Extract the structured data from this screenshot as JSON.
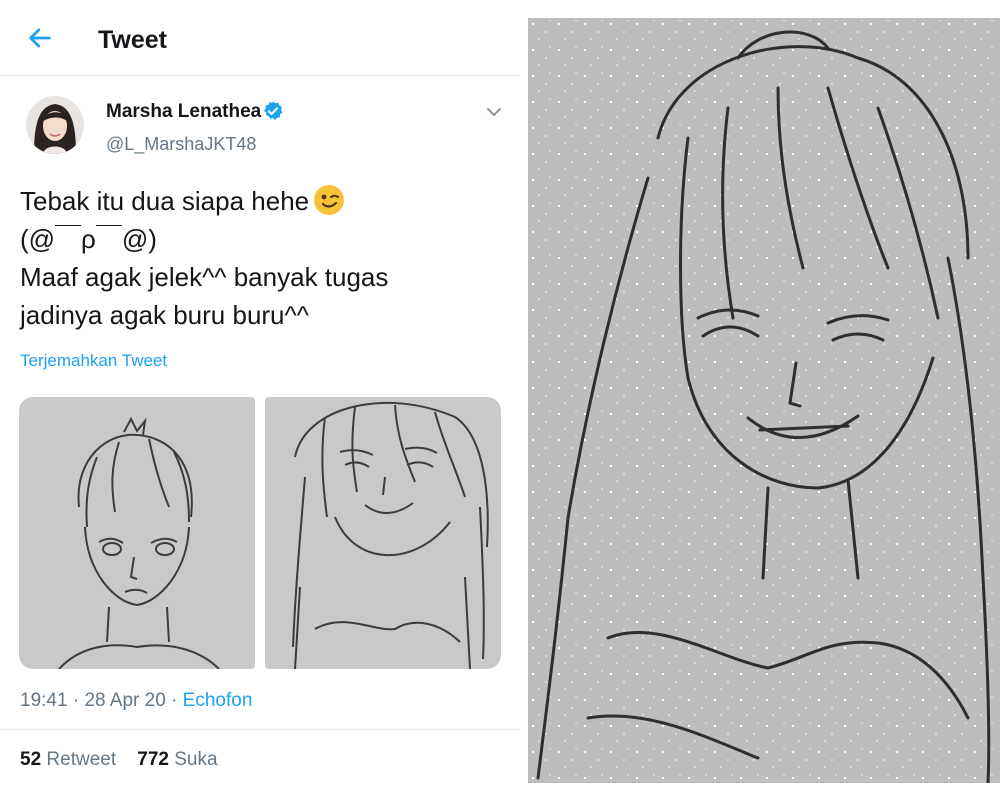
{
  "header": {
    "title": "Tweet"
  },
  "tweet": {
    "author_name": "Marsha Lenathea",
    "author_handle": "@L_MarshaJKT48",
    "text_line1": "Tebak itu dua siapa hehe",
    "text_rest": "(@￣ρ￣@)\nMaaf agak jelek^^ banyak tugas\njadinya agak buru buru^^",
    "translate_label": "Terjemahkan Tweet",
    "time": "19:41",
    "date": "28 Apr 20",
    "separator": "·",
    "source": "Echofon",
    "retweets_count": "52",
    "retweets_label": "Retweet",
    "likes_count": "772",
    "likes_label": "Suka"
  },
  "colors": {
    "accent": "#1da1f2",
    "muted": "#657786",
    "text": "#14171a",
    "divider": "#e6ecf0"
  },
  "icons": [
    "back-arrow-icon",
    "verified-badge-icon",
    "chevron-down-icon",
    "winking-face-emoji"
  ]
}
